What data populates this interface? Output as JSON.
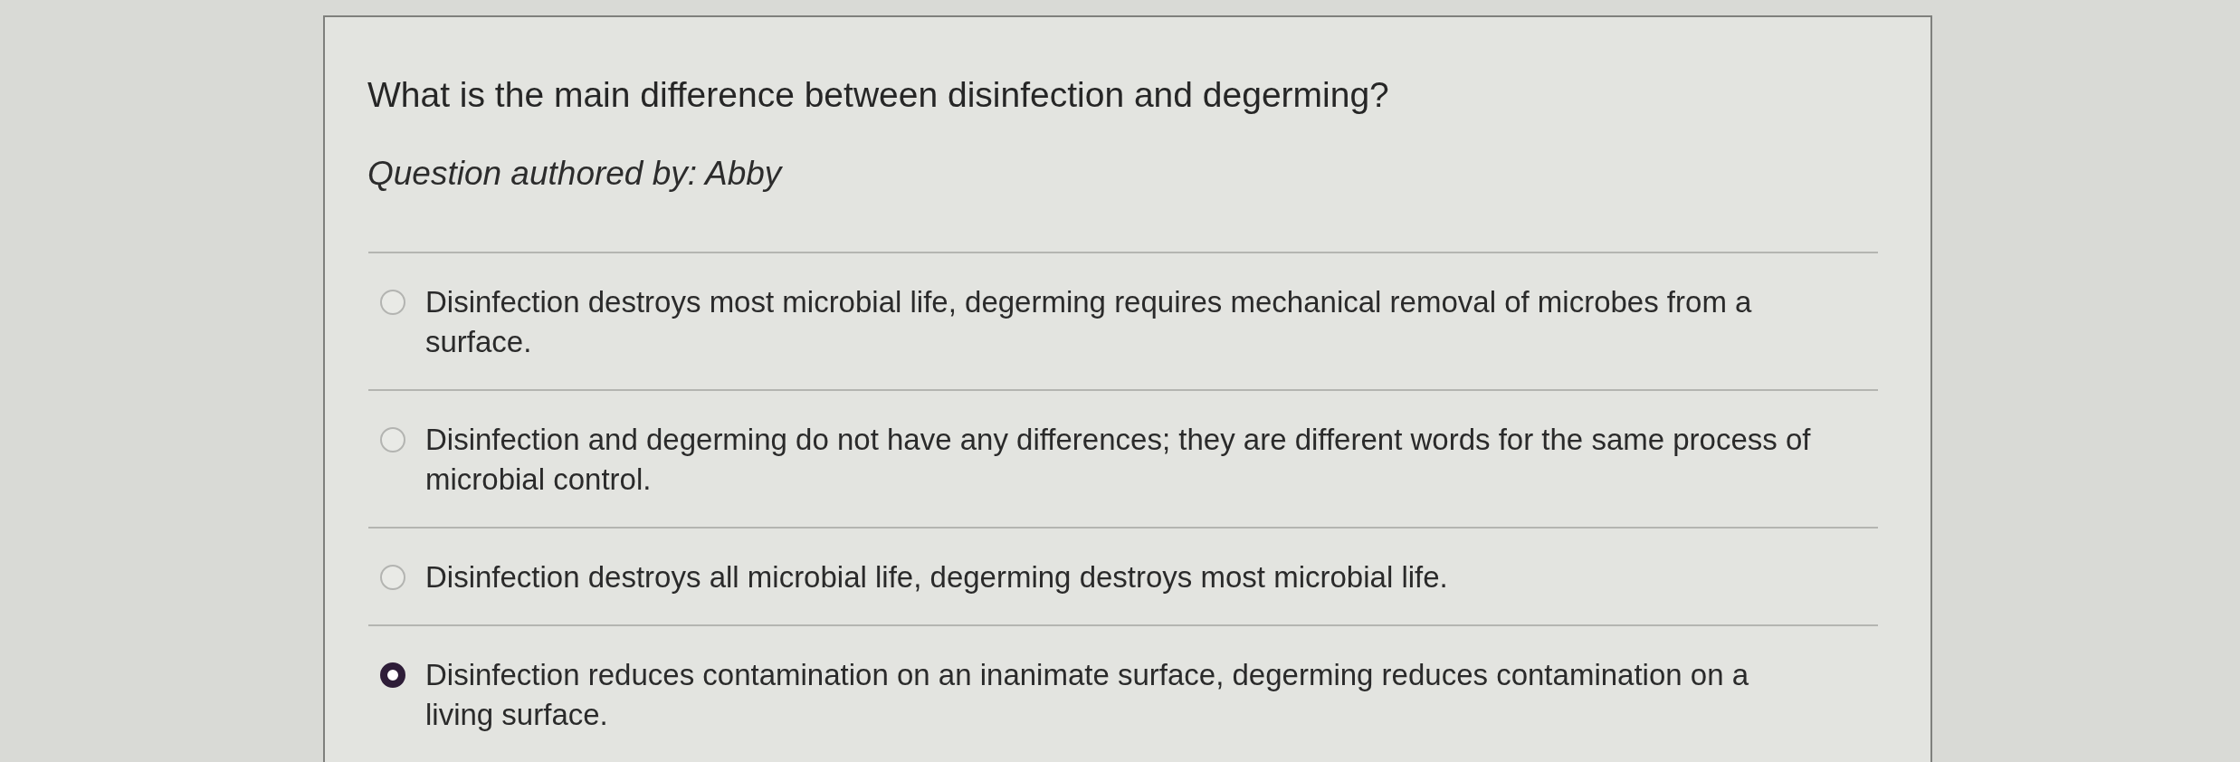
{
  "question": {
    "prompt": "What is the main difference between disinfection and degerming?",
    "author_line": "Question authored by: Abby"
  },
  "options": [
    {
      "text": "Disinfection destroys most microbial life, degerming requires mechanical removal of microbes from a surface.",
      "selected": false
    },
    {
      "text": "Disinfection and degerming do not have any differences; they are different words for the same process of microbial control.",
      "selected": false
    },
    {
      "text": "Disinfection destroys all microbial life, degerming destroys most microbial life.",
      "selected": false
    },
    {
      "text": "Disinfection reduces contamination on an inanimate surface, degerming reduces contamination on a living surface.",
      "selected": true
    }
  ]
}
